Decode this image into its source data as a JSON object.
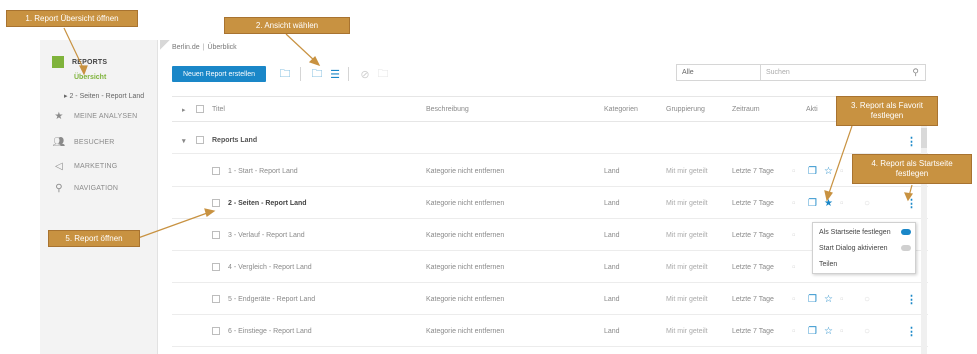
{
  "sidebar": {
    "reports": "REPORTS",
    "uebersicht": "Übersicht",
    "sub_item": "2 - Seiten - Report Land",
    "items": [
      {
        "label": "MEINE ANALYSEN",
        "icon": "star-icon"
      },
      {
        "label": "BESUCHER",
        "icon": "users-icon"
      },
      {
        "label": "MARKETING",
        "icon": "megaphone-icon"
      },
      {
        "label": "NAVIGATION",
        "icon": "navigation-icon"
      }
    ]
  },
  "breadcrumb": {
    "site": "Berlin.de",
    "sep": "|",
    "page": "Überblick"
  },
  "toolbar": {
    "new_report": "Neuen Report erstellen"
  },
  "filter": {
    "value": "Alle",
    "search_placeholder": "Suchen"
  },
  "table": {
    "headers": {
      "title": "Titel",
      "beschreibung": "Beschreibung",
      "kategorien": "Kategorien",
      "gruppierung": "Gruppierung",
      "zeitraum": "Zeitraum",
      "aktionen": "Akti"
    },
    "group": "Reports Land",
    "rows": [
      {
        "title": "1 - Start - Report Land",
        "desc": "Kategorie nicht entfernen",
        "cat": "Land",
        "grp": "Mit mir geteilt",
        "zeit": "Letzte 7 Tage"
      },
      {
        "title": "2 - Seiten - Report Land",
        "desc": "Kategorie nicht entfernen",
        "cat": "Land",
        "grp": "Mit mir geteilt",
        "zeit": "Letzte 7 Tage"
      },
      {
        "title": "3 - Verlauf - Report Land",
        "desc": "Kategorie nicht entfernen",
        "cat": "Land",
        "grp": "Mit mir geteilt",
        "zeit": "Letzte 7 Tage"
      },
      {
        "title": "4 - Vergleich - Report Land",
        "desc": "Kategorie nicht entfernen",
        "cat": "Land",
        "grp": "Mit mir geteilt",
        "zeit": "Letzte 7 Tage"
      },
      {
        "title": "5 - Endgeräte - Report Land",
        "desc": "Kategorie nicht entfernen",
        "cat": "Land",
        "grp": "Mit mir geteilt",
        "zeit": "Letzte 7 Tage"
      },
      {
        "title": "6 - Einstiege - Report Land",
        "desc": "Kategorie nicht entfernen",
        "cat": "Land",
        "grp": "Mit mir geteilt",
        "zeit": "Letzte 7 Tage"
      }
    ]
  },
  "context_menu": {
    "item1": "Als Startseite festlegen",
    "item2": "Start Dialog aktivieren",
    "item3": "Teilen"
  },
  "callouts": {
    "c1": "1. Report Übersicht öffnen",
    "c2": "2. Ansicht wählen",
    "c3": "3. Report als Favorit festlegen",
    "c4": "4. Report als Startseite festlegen",
    "c5": "5. Report öffnen"
  },
  "colors": {
    "accent": "#1a87c8",
    "green": "#7fb33b",
    "callout": "#c89241"
  }
}
